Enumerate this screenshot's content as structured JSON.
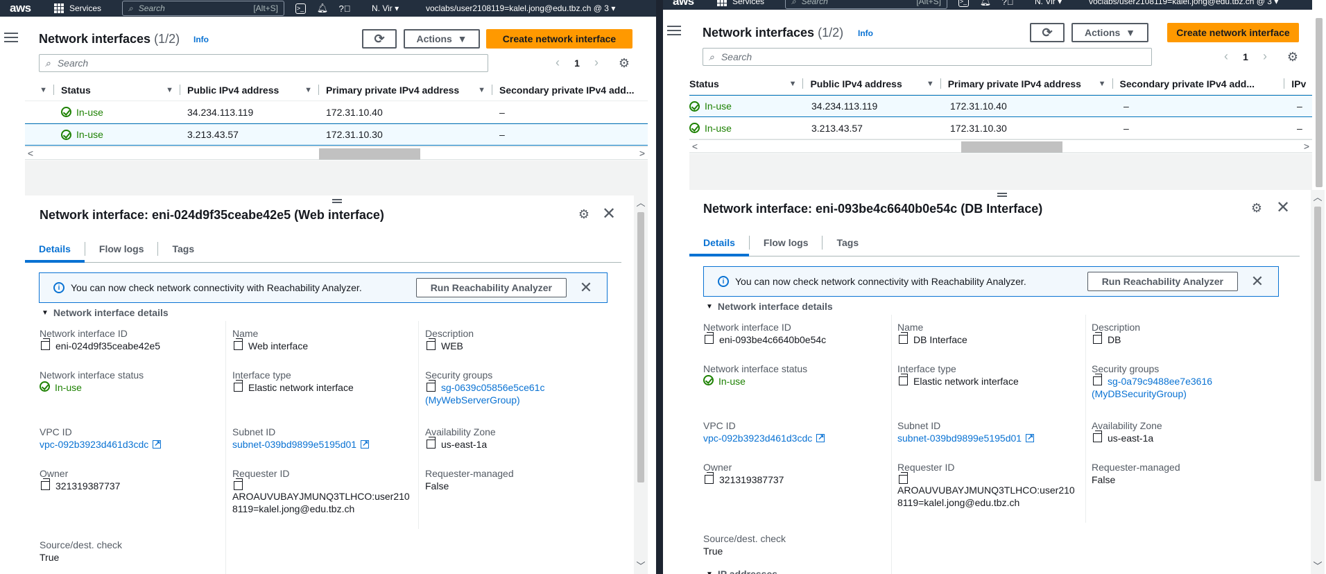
{
  "topbar": {
    "logo": "aws",
    "services_label": "Services",
    "search_placeholder": "Search",
    "search_shortcut": "[Alt+S]",
    "region": "N. Vir",
    "user": "voclabs/user2108119=kalel.jong@edu.tbz.ch @ 3"
  },
  "list": {
    "title": "Network interfaces",
    "count": "(1/2)",
    "info": "Info",
    "actions_label": "Actions",
    "create_label": "Create network interface",
    "search_placeholder": "Search",
    "page": "1",
    "columns": [
      "Status",
      "Public IPv4 address",
      "Primary private IPv4 address",
      "Secondary private IPv4 add...",
      "IPv"
    ],
    "rows": [
      {
        "status": "In-use",
        "public_ip": "34.234.113.119",
        "private_ip": "172.31.10.40",
        "secondary_ip": "–",
        "ipv6": "–"
      },
      {
        "status": "In-use",
        "public_ip": "3.213.43.57",
        "private_ip": "172.31.10.30",
        "secondary_ip": "–",
        "ipv6": "–"
      }
    ]
  },
  "tabs": [
    "Details",
    "Flow logs",
    "Tags"
  ],
  "flash": {
    "message": "You can now check network connectivity with Reachability Analyzer.",
    "button": "Run Reachability Analyzer"
  },
  "section_title": "Network interface details",
  "labels": {
    "eni_id": "Network interface ID",
    "name": "Name",
    "description": "Description",
    "status": "Network interface status",
    "interface_type": "Interface type",
    "security_groups": "Security groups",
    "vpc_id": "VPC ID",
    "subnet_id": "Subnet ID",
    "az": "Availability Zone",
    "owner": "Owner",
    "requester_id": "Requester ID",
    "requester_managed": "Requester-managed",
    "source_dest": "Source/dest. check",
    "ip_addresses": "IP addresses"
  },
  "left_detail": {
    "title": "Network interface: eni-024d9f35ceabe42e5 (Web interface)",
    "eni_id": "eni-024d9f35ceabe42e5",
    "name": "Web interface",
    "description": "WEB",
    "status": "In-use",
    "interface_type": "Elastic network interface",
    "security_group_id": "sg-0639c05856e5ce61c",
    "security_group_name": "(MyWebServerGroup)",
    "vpc_id": "vpc-092b3923d461d3cdc",
    "subnet_id": "subnet-039bd9899e5195d01",
    "az": "us-east-1a",
    "owner": "321319387737",
    "requester_id": "AROAUVUBAYJMUNQ3TLHCO:user2108119=kalel.jong@edu.tbz.ch",
    "requester_managed": "False",
    "source_dest": "True"
  },
  "right_detail": {
    "title": "Network interface: eni-093be4c6640b0e54c (DB Interface)",
    "eni_id": "eni-093be4c6640b0e54c",
    "name": "DB Interface",
    "description": "DB",
    "status": "In-use",
    "interface_type": "Elastic network interface",
    "security_group_id": "sg-0a79c9488ee7e3616",
    "security_group_name": "(MyDBSecurityGroup)",
    "vpc_id": "vpc-092b3923d461d3cdc",
    "subnet_id": "subnet-039bd9899e5195d01",
    "az": "us-east-1a",
    "owner": "321319387737",
    "requester_id": "AROAUVUBAYJMUNQ3TLHCO:user2108119=kalel.jong@edu.tbz.ch",
    "requester_managed": "False",
    "source_dest": "True"
  },
  "colors": {
    "accent": "#0972d3",
    "primary_button": "#ff9900",
    "topbar": "#232f3e",
    "success": "#1d8102"
  }
}
